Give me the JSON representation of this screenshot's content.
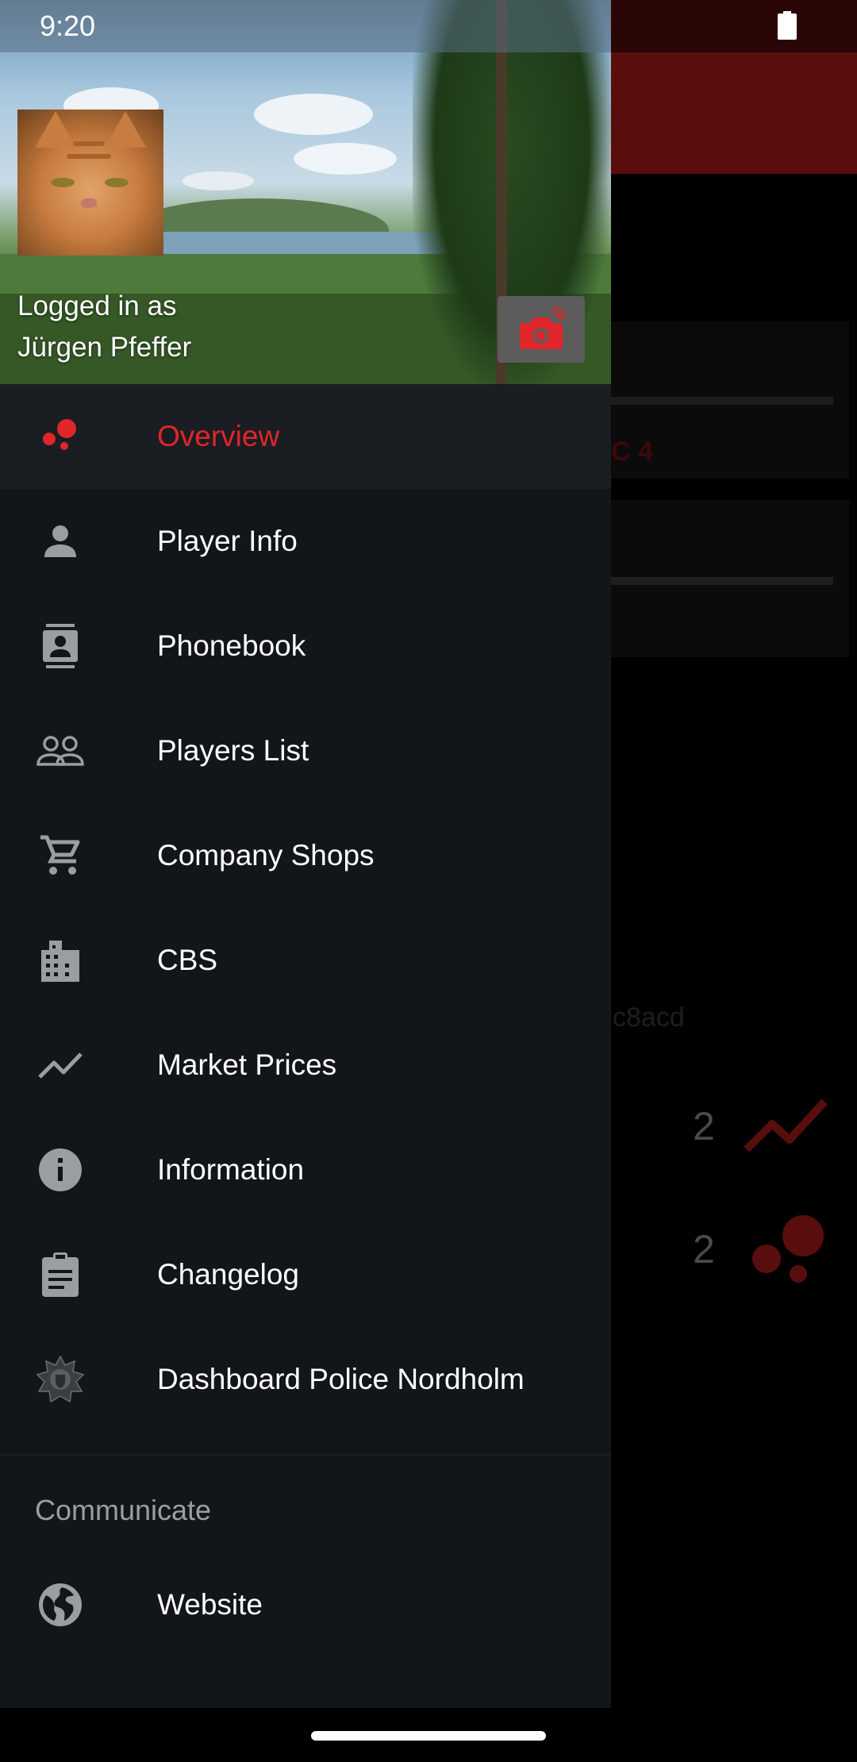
{
  "status_bar": {
    "time": "9:20",
    "battery_icon": "battery-full-icon"
  },
  "background_app": {
    "card_1_text": "C 4",
    "hash_text": "c8acd",
    "stat_1_value": "2",
    "stat_1_icon": "trend-line-icon",
    "stat_2_value": "2",
    "stat_2_icon": "bubbles-icon",
    "toolbar_color": "#5a0d0d"
  },
  "drawer": {
    "header": {
      "logged_in_prefix": "Logged in as",
      "user_name": "Jürgen Pfeffer",
      "camera_icon": "camera-switch-icon"
    },
    "items": [
      {
        "label": "Overview",
        "icon": "bubbles-icon",
        "active": true
      },
      {
        "label": "Player Info",
        "icon": "person-icon",
        "active": false
      },
      {
        "label": "Phonebook",
        "icon": "contacts-icon",
        "active": false
      },
      {
        "label": "Players List",
        "icon": "people-outline-icon",
        "active": false
      },
      {
        "label": "Company Shops",
        "icon": "shopping-cart-icon",
        "active": false
      },
      {
        "label": "CBS",
        "icon": "building-icon",
        "active": false
      },
      {
        "label": "Market Prices",
        "icon": "trend-line-icon",
        "active": false
      },
      {
        "label": "Information",
        "icon": "info-icon",
        "active": false
      },
      {
        "label": "Changelog",
        "icon": "clipboard-icon",
        "active": false
      },
      {
        "label": "Dashboard Police Nordholm",
        "icon": "police-badge-icon",
        "active": false
      }
    ],
    "section_title": "Communicate",
    "communicate_items": [
      {
        "label": "Website",
        "icon": "globe-icon",
        "active": false
      }
    ]
  },
  "colors": {
    "accent": "#e0262a",
    "drawer_bg": "#12161a",
    "icon_grey": "#9a9ea2"
  }
}
